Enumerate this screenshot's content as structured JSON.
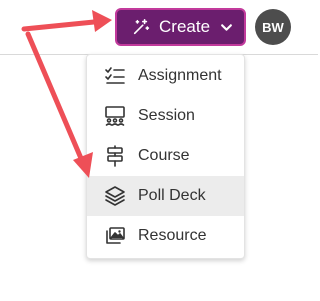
{
  "header": {
    "create_button": {
      "label": "Create"
    },
    "avatar": {
      "initials": "BW"
    }
  },
  "create_menu": {
    "items": [
      {
        "label": "Assignment",
        "icon": "checklist-icon"
      },
      {
        "label": "Session",
        "icon": "presentation-audience-icon"
      },
      {
        "label": "Course",
        "icon": "signpost-icon"
      },
      {
        "label": "Poll Deck",
        "icon": "layers-stack-icon",
        "highlighted": true
      },
      {
        "label": "Resource",
        "icon": "images-icon"
      }
    ]
  },
  "colors": {
    "create_button_bg": "#6b1e6e",
    "create_button_border": "#c23a9c",
    "avatar_bg": "#4d4d4d",
    "annotation_arrow": "#ee4f57",
    "menu_highlight": "#ececec"
  }
}
